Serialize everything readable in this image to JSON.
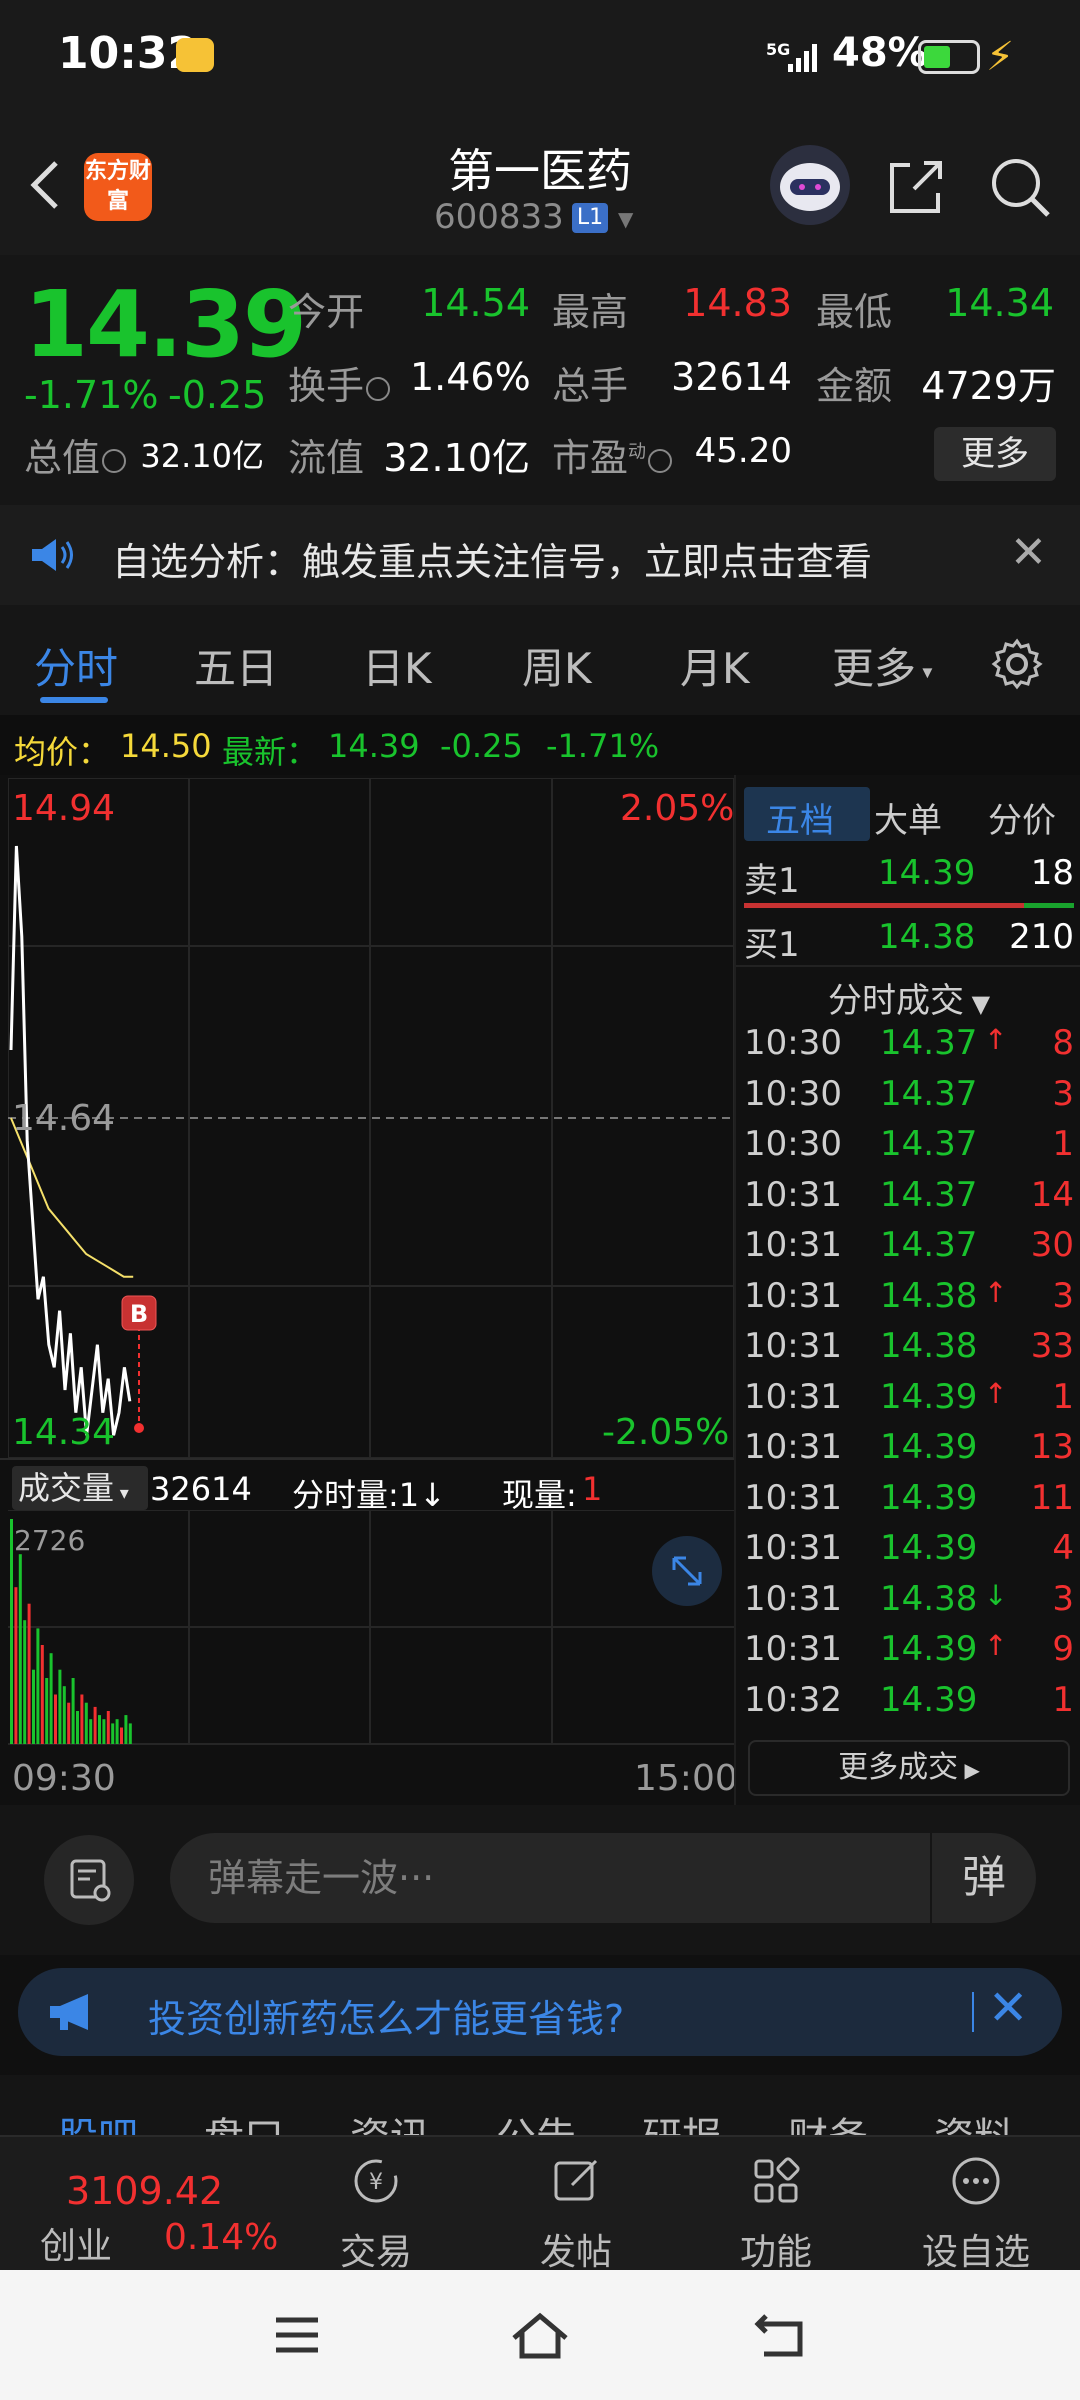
{
  "status_bar": {
    "time": "10:32",
    "network": "5G",
    "battery": "48%"
  },
  "header": {
    "logo_text": "东方财富",
    "stock_name": "第一医药",
    "stock_code": "600833",
    "level_badge": "L1"
  },
  "quote": {
    "last_price": "14.39",
    "change_pct": "-1.71%",
    "change_val": "-0.25",
    "fields": {
      "open_label": "今开",
      "open_value": "14.54",
      "high_label": "最高",
      "high_value": "14.83",
      "low_label": "最低",
      "low_value": "14.34",
      "turnover_label": "换手",
      "turnover_value": "1.46%",
      "volume_label": "总手",
      "volume_value": "32614",
      "amount_label": "金额",
      "amount_value": "4729万",
      "mktcap_label": "总值",
      "mktcap_value": "32.10亿",
      "float_label": "流值",
      "float_value": "32.10亿",
      "pe_label": "市盈",
      "pe_sup": "动",
      "pe_value": "45.20"
    },
    "more_button": "更多"
  },
  "alert": {
    "text": "自选分析：触发重点关注信号，立即点击查看"
  },
  "tabs": {
    "items": [
      "分时",
      "五日",
      "日K",
      "周K",
      "月K",
      "更多"
    ],
    "active": "分时"
  },
  "avg_bar": {
    "avg_label": "均价：",
    "avg_value": "14.50",
    "latest_label": "最新：",
    "latest_value": "14.39",
    "latest_change": "-0.25",
    "latest_pct": "-1.71%"
  },
  "chart": {
    "top_price": "14.94",
    "top_pct": "2.05%",
    "mid_price": "14.64",
    "bottom_price": "14.34",
    "bottom_pct": "-2.05%",
    "buy_marker": "B",
    "volume_selector": "成交量",
    "volume_total": "32614",
    "period_label": "分时量:1",
    "period_arrow": "↓",
    "current_label": "现量:",
    "current_value": "1",
    "volume_max": "2726",
    "time_start": "09:30",
    "time_end": "15:00",
    "colors": {
      "price_line": "#ffffff",
      "avg_line": "#f5e06a",
      "up": "#f23030",
      "down": "#19c32d"
    }
  },
  "chart_data": {
    "type": "line",
    "series": [
      {
        "values": [
          14.7,
          14.88,
          14.8,
          14.62,
          14.55,
          14.48,
          14.5,
          14.44,
          14.42,
          14.47,
          14.4,
          14.45,
          14.38,
          14.42,
          14.36,
          14.4,
          14.44,
          14.38,
          14.41,
          14.36,
          14.38,
          14.42,
          14.39
        ]
      },
      {
        "values": [
          14.64,
          14.62,
          14.6,
          14.58,
          14.56,
          14.55,
          14.54,
          14.53,
          14.52,
          14.515,
          14.51,
          14.505,
          14.5,
          14.5
        ]
      }
    ],
    "volume": [
      2726,
      1900,
      2300,
      1500,
      1700,
      900,
      1400,
      1200,
      800,
      1100,
      600,
      900,
      700,
      500,
      800,
      400,
      600,
      500,
      300,
      450,
      350,
      300,
      400,
      250,
      300,
      200,
      350,
      250
    ],
    "ylim": [
      14.34,
      14.94
    ]
  },
  "order_book": {
    "tabs": [
      "五档",
      "大单",
      "分价"
    ],
    "sell1": {
      "label": "卖1",
      "price": "14.39",
      "vol": "18"
    },
    "buy1": {
      "label": "买1",
      "price": "14.38",
      "vol": "210"
    },
    "ticks_title": "分时成交",
    "ticks": [
      {
        "time": "10:30",
        "price": "14.37",
        "dir": "↑",
        "vol": "8"
      },
      {
        "time": "10:30",
        "price": "14.37",
        "dir": "",
        "vol": "3"
      },
      {
        "time": "10:30",
        "price": "14.37",
        "dir": "",
        "vol": "1"
      },
      {
        "time": "10:31",
        "price": "14.37",
        "dir": "",
        "vol": "14"
      },
      {
        "time": "10:31",
        "price": "14.37",
        "dir": "",
        "vol": "30"
      },
      {
        "time": "10:31",
        "price": "14.38",
        "dir": "↑",
        "vol": "3"
      },
      {
        "time": "10:31",
        "price": "14.38",
        "dir": "",
        "vol": "33"
      },
      {
        "time": "10:31",
        "price": "14.39",
        "dir": "↑",
        "vol": "1"
      },
      {
        "time": "10:31",
        "price": "14.39",
        "dir": "",
        "vol": "13"
      },
      {
        "time": "10:31",
        "price": "14.39",
        "dir": "",
        "vol": "11"
      },
      {
        "time": "10:31",
        "price": "14.39",
        "dir": "",
        "vol": "4"
      },
      {
        "time": "10:31",
        "price": "14.38",
        "dir": "↓",
        "vol": "3"
      },
      {
        "time": "10:31",
        "price": "14.39",
        "dir": "↑",
        "vol": "9"
      },
      {
        "time": "10:32",
        "price": "14.39",
        "dir": "",
        "vol": "1"
      }
    ],
    "more_ticks": "更多成交"
  },
  "comment": {
    "placeholder": "弹幕走一波···",
    "danmu_label": "弹"
  },
  "promo": {
    "text": "投资创新药怎么才能更省钱?"
  },
  "section_tabs": [
    "股吧",
    "盘口",
    "资讯",
    "公告",
    "研报",
    "财务",
    "资料"
  ],
  "bottom_nav": {
    "index_value": "3109.42",
    "index_name": "创业",
    "index_pct": "0.14%",
    "items": [
      "交易",
      "发帖",
      "功能",
      "设自选"
    ]
  }
}
